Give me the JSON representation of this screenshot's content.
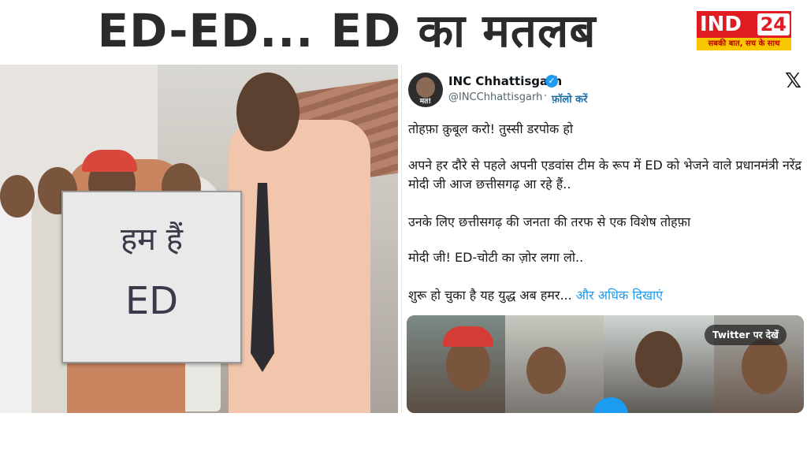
{
  "headline": "ED-ED... ED का मतलब",
  "logo": {
    "brand_a": "IND",
    "brand_b": "24",
    "tagline": "सबकी बात, सच के साथ"
  },
  "photo": {
    "sign_line1": "हम हैं",
    "sign_line2": "ED"
  },
  "tweet": {
    "account_name": "INC Chhattisgarh",
    "handle": "@INCChhattisgarh",
    "separator": "·",
    "follow_label": "फ़ॉलो करें",
    "avatar_text": "मत!",
    "close_glyph": "𝕏",
    "paragraphs": [
      "तोहफ़ा क़ुबूल करो! तुस्सी डरपोक हो",
      "अपने हर दौरे से पहले अपनी एडवांस टीम के रूप में ED को भेजने वाले प्रधानमंत्री नरेंद्र मोदी जी आज छत्तीसगढ़ आ रहे हैं..",
      "उनके लिए छत्तीसगढ़ की जनता की तरफ से एक विशेष तोहफ़ा",
      "मोदी जी! ED-चोटी का ज़ोर लगा लो..",
      "शुरू हो चुका है यह युद्ध अब हमर..."
    ],
    "show_more": " और अधिक दिखाएं",
    "media_pill": "Twitter पर देखें"
  },
  "colors": {
    "brand_red": "#e11b22",
    "brand_yellow": "#f7c700",
    "link_blue": "#1d9bf0",
    "verified_blue": "#1d9bf0"
  },
  "icons": {
    "verified": "verified-badge-icon",
    "close": "x-logo-icon",
    "play": "play-icon"
  }
}
